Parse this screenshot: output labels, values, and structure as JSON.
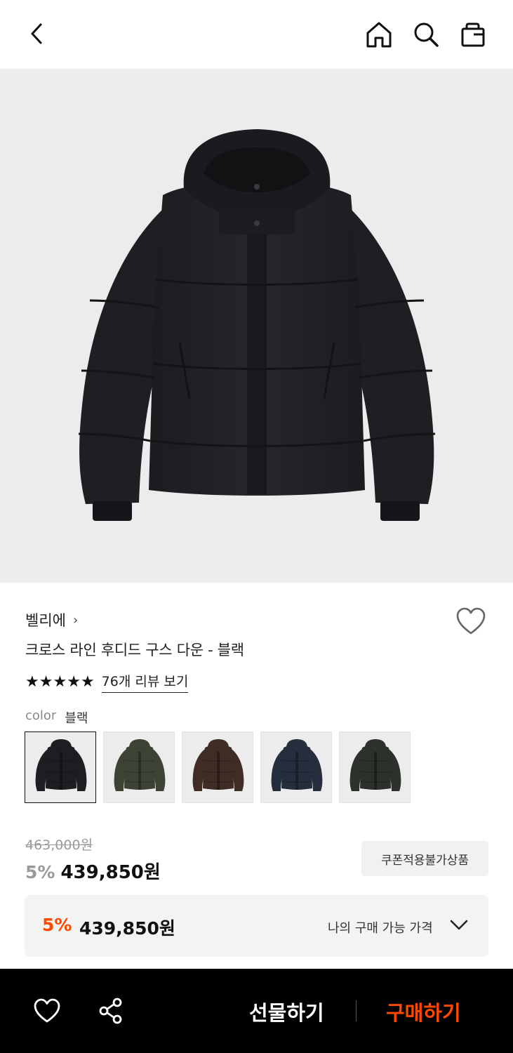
{
  "header": {
    "back_icon": "chevron-left-icon",
    "home_icon": "home-icon",
    "search_icon": "search-icon",
    "bag_icon": "shopping-bag-icon"
  },
  "product": {
    "brand": "벨리에",
    "brand_chevron": "›",
    "name": "크로스 라인 후디드 구스 다운 - 블랙",
    "rating_stars": 5,
    "review_link": "76개 리뷰 보기",
    "color_label": "color",
    "color_value": "블랙",
    "swatch_colors": [
      "#1d1e21",
      "#3d4334",
      "#3e2c25",
      "#262d3c",
      "#2c312b"
    ],
    "original_price": "463,000원",
    "discount_pct": "5%",
    "sale_price": "439,850원",
    "coupon_note": "쿠폰적용불가상품",
    "my_price": {
      "pct": "5%",
      "amount": "439,850원",
      "label": "나의 구매 가능 가격"
    }
  },
  "bottom_bar": {
    "gift_label": "선물하기",
    "buy_label": "구매하기"
  },
  "colors": {
    "accent": "#ff4800",
    "hero_bg": "#ececec",
    "bar_bg": "#000000"
  }
}
